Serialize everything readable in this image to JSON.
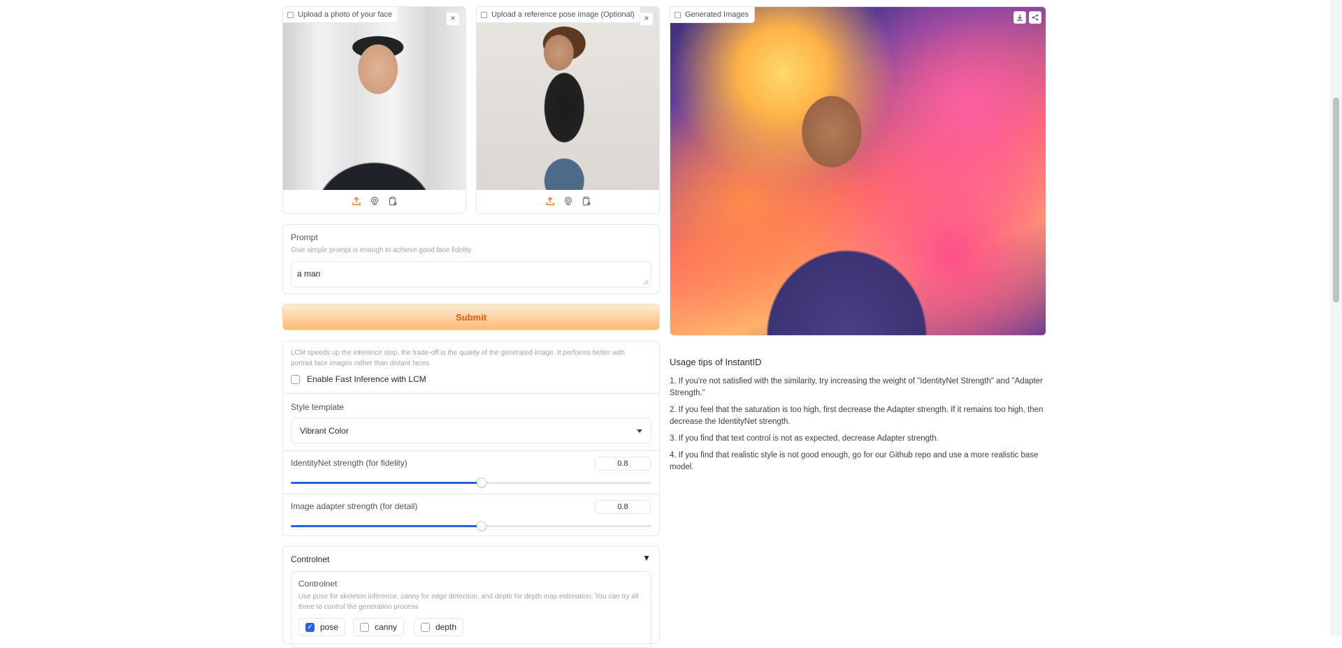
{
  "face_upload": {
    "label": "Upload a photo of your face",
    "close": "×"
  },
  "pose_upload": {
    "label": "Upload a reference pose image (Optional)",
    "close": "×"
  },
  "generated": {
    "label": "Generated Images"
  },
  "prompt": {
    "label": "Prompt",
    "info": "Give simple prompt is enough to achieve good face fidelity",
    "value": "a man"
  },
  "submit_label": "Submit",
  "lcm": {
    "info": "LCM speeds up the inference step, the trade-off is the quality of the generated image. It performs better with portrait face images rather than distant faces",
    "checkbox_label": "Enable Fast Inference with LCM",
    "checked": false
  },
  "style": {
    "label": "Style template",
    "value": "Vibrant Color"
  },
  "identitynet": {
    "label": "IdentityNet strength (for fidelity)",
    "value": "0.8",
    "fraction": 0.53
  },
  "adapter": {
    "label": "Image adapter strength (for detail)",
    "value": "0.8",
    "fraction": 0.53
  },
  "controlnet": {
    "header": "Controlnet",
    "toggle": "▼",
    "title": "Controlnet",
    "info": "Use pose for skeleton inference, canny for edge detection, and depth for depth map estimation. You can try all three to control the generation process",
    "options": [
      {
        "label": "pose",
        "checked": true
      },
      {
        "label": "canny",
        "checked": false
      },
      {
        "label": "depth",
        "checked": false
      }
    ]
  },
  "tips": {
    "title": "Usage tips of InstantID",
    "items": [
      "1. If you're not satisfied with the similarity, try increasing the weight of \"IdentityNet Strength\" and \"Adapter Strength.\"",
      "2. If you feel that the saturation is too high, first decrease the Adapter strength. If it remains too high, then decrease the IdentityNet strength.",
      "3. If you find that text control is not as expected, decrease Adapter strength.",
      "4. If you find that realistic style is not good enough, go for our Github repo and use a more realistic base model."
    ]
  },
  "colors": {
    "accent": "#2563eb",
    "submit_text": "#ea580c",
    "upload_icon": "#f97316"
  }
}
